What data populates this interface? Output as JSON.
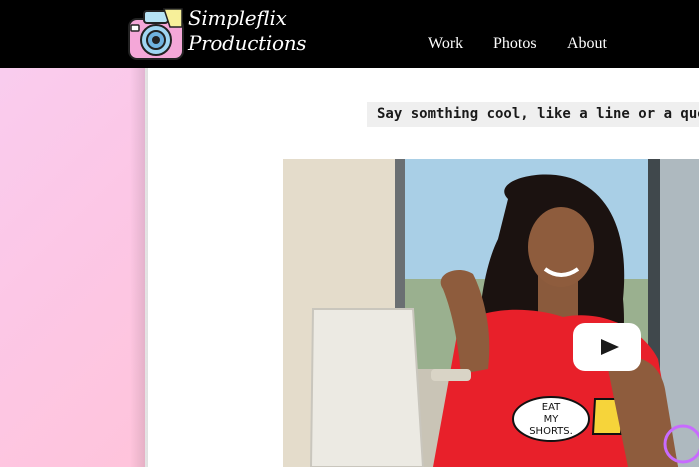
{
  "brand": {
    "line1": "Simpleflix",
    "line2": "Productions"
  },
  "nav": {
    "links": [
      "Work",
      "Photos",
      "About"
    ]
  },
  "quote": {
    "text": "Say somthing cool, like a line or a quote"
  },
  "video": {
    "shirt_text": [
      "EAT",
      "MY",
      "SHORTS."
    ]
  },
  "colors": {
    "navbar": "#000000",
    "sidebar_pink": "#fcc7e6",
    "quote_bg": "#efefef",
    "shirt_red": "#e8202a"
  }
}
